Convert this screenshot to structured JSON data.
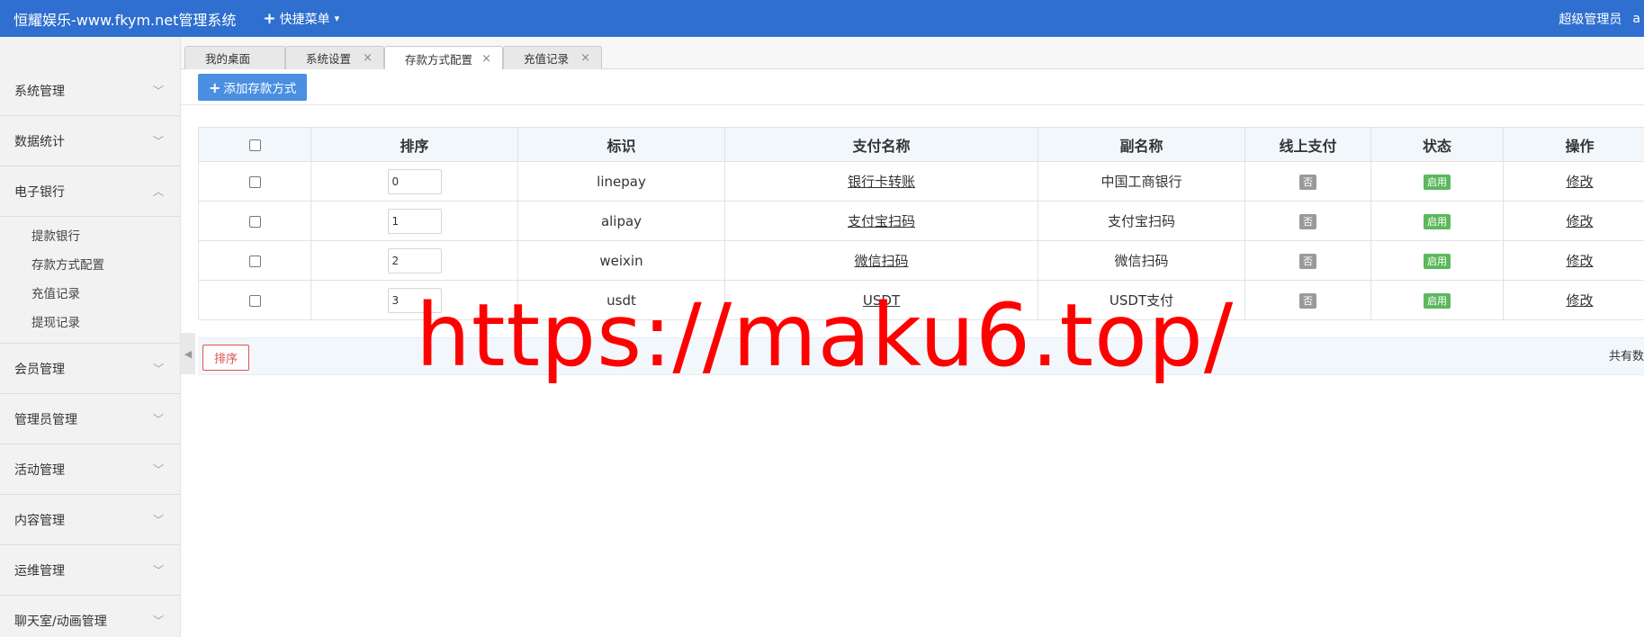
{
  "header": {
    "app_title": "恒耀娱乐-www.fkym.net管理系统",
    "quick_menu_label": "快捷菜单",
    "user_label": "超级管理员",
    "user_extra": "a"
  },
  "sidebar": {
    "items": [
      {
        "label": "系统管理"
      },
      {
        "label": "数据统计"
      },
      {
        "label": "电子银行"
      },
      {
        "label": "会员管理"
      },
      {
        "label": "管理员管理"
      },
      {
        "label": "活动管理"
      },
      {
        "label": "内容管理"
      },
      {
        "label": "运维管理"
      },
      {
        "label": "聊天室/动画管理"
      }
    ],
    "submenu": [
      {
        "label": "提款银行"
      },
      {
        "label": "存款方式配置"
      },
      {
        "label": "充值记录"
      },
      {
        "label": "提现记录"
      }
    ]
  },
  "tabs": [
    {
      "label": "我的桌面"
    },
    {
      "label": "系统设置"
    },
    {
      "label": "存款方式配置"
    },
    {
      "label": "充值记录"
    }
  ],
  "toolbar": {
    "add_label": "添加存款方式"
  },
  "table": {
    "headers": [
      "排序",
      "标识",
      "支付名称",
      "副名称",
      "线上支付",
      "状态",
      "操作"
    ],
    "rows": [
      {
        "order": "0",
        "code": "linepay",
        "name": "银行卡转账",
        "subname": "中国工商银行",
        "online": "否",
        "status": "启用",
        "action": "修改"
      },
      {
        "order": "1",
        "code": "alipay",
        "name": "支付宝扫码",
        "subname": "支付宝扫码",
        "online": "否",
        "status": "启用",
        "action": "修改"
      },
      {
        "order": "2",
        "code": "weixin",
        "name": "微信扫码",
        "subname": "微信扫码",
        "online": "否",
        "status": "启用",
        "action": "修改"
      },
      {
        "order": "3",
        "code": "usdt",
        "name": "USDT",
        "subname": "USDT支付",
        "online": "否",
        "status": "启用",
        "action": "修改"
      }
    ]
  },
  "footer": {
    "sort_label": "排序",
    "total_text": "共有数"
  },
  "watermark": {
    "text": "https://maku6.top/"
  },
  "colors": {
    "topbar": "#2f6fcf",
    "add_button": "#4a8fe2",
    "enabled_badge": "#5cb85c",
    "no_badge": "#9a9a9a",
    "sort_button": "#d9534f",
    "watermark": "#ff0000"
  }
}
